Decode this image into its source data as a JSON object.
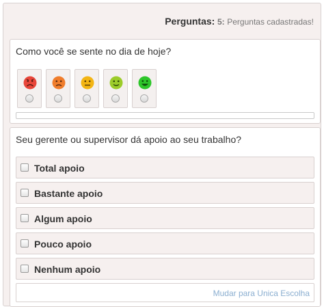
{
  "header": {
    "title": "Perguntas:",
    "count": "5:",
    "desc": "Perguntas cadastradas!"
  },
  "question1": {
    "text": "Como você se sente no dia de hoje?",
    "faces": [
      {
        "icon": "very-sad-face-icon",
        "color": "#e8463a"
      },
      {
        "icon": "sad-face-icon",
        "color": "#f07d2c"
      },
      {
        "icon": "neutral-face-icon",
        "color": "#f3b514"
      },
      {
        "icon": "happy-face-icon",
        "color": "#9ccc2a"
      },
      {
        "icon": "very-happy-face-icon",
        "color": "#2dc62a"
      }
    ]
  },
  "question2": {
    "text": "Seu gerente ou supervisor dá apoio ao seu trabalho?",
    "options": [
      "Total apoio",
      "Bastante apoio",
      "Algum apoio",
      "Pouco apoio",
      "Nenhum apoio"
    ],
    "switch_link": "Mudar para Unica Escolha"
  }
}
